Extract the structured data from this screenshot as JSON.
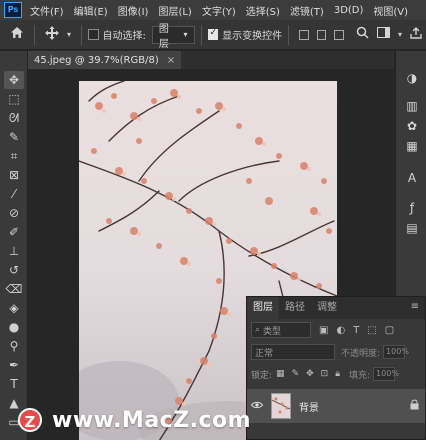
{
  "app": {
    "logo": "Ps"
  },
  "menu": [
    "文件(F)",
    "编辑(E)",
    "图像(I)",
    "图层(L)",
    "文字(Y)",
    "选择(S)",
    "滤镜(T)",
    "3D(D)",
    "视图(V)"
  ],
  "options": {
    "auto_select_label": "自动选择:",
    "target_value": "图层",
    "show_transform_label": "显示变换控件",
    "auto_select_checked": false,
    "show_transform_checked": true
  },
  "document": {
    "tab_title": "45.jpeg @ 39.7%(RGB/8)",
    "close_glyph": "×"
  },
  "layers_panel": {
    "tabs": [
      "图层",
      "路径",
      "调整"
    ],
    "active_tab": "图层",
    "filter_placeholder": "类型",
    "blend_mode": "正常",
    "opacity_label": "不透明度:",
    "opacity_value": "100%",
    "lock_label": "锁定:",
    "fill_label": "填充:",
    "fill_value": "100%",
    "layer": {
      "name": "背景",
      "visible": true,
      "locked": true
    }
  },
  "watermark": {
    "logo_letter": "Z",
    "text": "www.MacZ.com"
  },
  "colors": {
    "accent": "#31a8ff",
    "panel_bg": "#383838",
    "canvas_bg": "#262626",
    "watermark_logo": "#e84949"
  },
  "icons": {
    "home": "home-icon",
    "move": "move-icon",
    "search": "search-icon",
    "workspace": "workspace-icon",
    "share": "share-icon"
  }
}
